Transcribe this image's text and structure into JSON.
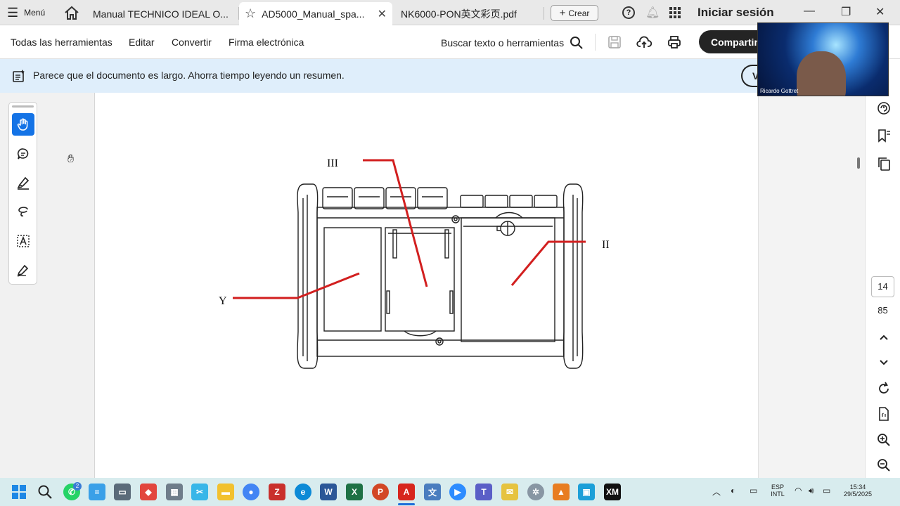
{
  "titlebar": {
    "menu_label": "Menú",
    "tabs": [
      {
        "label": "Manual TECHNICO IDEAL O..."
      },
      {
        "label": "AD5000_Manual_spa..."
      },
      {
        "label": "NK6000-PON英文彩页.pdf"
      }
    ],
    "create_label": "Crear",
    "signin_label": "Iniciar sesión"
  },
  "toolbar": {
    "items": [
      "Todas las herramientas",
      "Editar",
      "Convertir",
      "Firma electrónica"
    ],
    "search_label": "Buscar texto o herramientas",
    "share_label": "Compartir"
  },
  "banner": {
    "text": "Parece que el documento es largo. Ahorra tiempo leyendo un resumen.",
    "button_label": "V"
  },
  "diagram": {
    "labels": {
      "top": "III",
      "right": "II",
      "left": "Y"
    },
    "accent_color": "#d21f1f"
  },
  "pagination": {
    "current": "14",
    "total": "85"
  },
  "video": {
    "participant": "Ricardo Gottret"
  },
  "taskbar": {
    "lang": "ESP",
    "layout": "INTL",
    "time": "15:34",
    "date": "29/5/2025",
    "badge": "2"
  }
}
